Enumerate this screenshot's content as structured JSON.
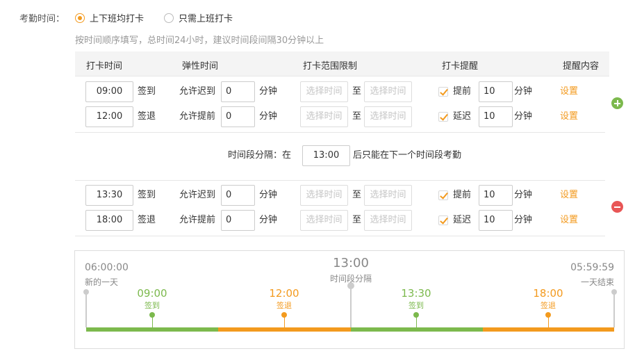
{
  "attendance_label": "考勤时间：",
  "mode_options": [
    {
      "label": "上下班均打卡",
      "checked": true
    },
    {
      "label": "只需上班打卡",
      "checked": false
    }
  ],
  "hint": "按时间顺序填写，总时间24小时，建议时间段间隔30分钟以上",
  "table_headers": [
    "打卡时间",
    "弹性时间",
    "打卡范围限制",
    "打卡提醒",
    "提醒内容"
  ],
  "period1": {
    "rows": [
      {
        "time": "09:00",
        "type": "签到",
        "flex_label": "允许迟到",
        "flex_value": "0",
        "flex_unit": "分钟",
        "range_from": "选择时间",
        "range_sep": "至",
        "range_to": "选择时间",
        "remind_checked": true,
        "remind_label": "提前",
        "remind_value": "10",
        "remind_unit": "分钟",
        "settings": "设置"
      },
      {
        "time": "12:00",
        "type": "签退",
        "flex_label": "允许提前",
        "flex_value": "0",
        "flex_unit": "分钟",
        "range_from": "选择时间",
        "range_sep": "至",
        "range_to": "选择时间",
        "remind_checked": true,
        "remind_label": "延迟",
        "remind_value": "10",
        "remind_unit": "分钟",
        "settings": "设置"
      }
    ]
  },
  "separator": {
    "prefix": "时间段分隔：在",
    "time": "13:00",
    "suffix": "后只能在下一个时间段考勤"
  },
  "period2": {
    "rows": [
      {
        "time": "13:30",
        "type": "签到",
        "flex_label": "允许迟到",
        "flex_value": "0",
        "flex_unit": "分钟",
        "range_from": "选择时间",
        "range_sep": "至",
        "range_to": "选择时间",
        "remind_checked": true,
        "remind_label": "提前",
        "remind_value": "10",
        "remind_unit": "分钟",
        "settings": "设置"
      },
      {
        "time": "18:00",
        "type": "签退",
        "flex_label": "允许提前",
        "flex_value": "0",
        "flex_unit": "分钟",
        "range_from": "选择时间",
        "range_sep": "至",
        "range_to": "选择时间",
        "remind_checked": true,
        "remind_label": "延迟",
        "remind_value": "10",
        "remind_unit": "分钟",
        "settings": "设置"
      }
    ]
  },
  "timeline": {
    "start": {
      "time": "06:00:00",
      "label": "新的一天"
    },
    "end": {
      "time": "05:59:59",
      "label": "一天结束"
    },
    "divider": {
      "time": "13:00",
      "label": "时间段分隔"
    },
    "markers": [
      {
        "time": "09:00",
        "label": "签到",
        "color": "#7cb94d"
      },
      {
        "time": "12:00",
        "label": "签退",
        "color": "#f39a1e"
      },
      {
        "time": "13:30",
        "label": "签到",
        "color": "#7cb94d"
      },
      {
        "time": "18:00",
        "label": "签退",
        "color": "#f39a1e"
      }
    ]
  },
  "colors": {
    "accent": "#f39a1e",
    "green": "#7cb94d",
    "add": "#7cb94d",
    "remove": "#e85656"
  }
}
